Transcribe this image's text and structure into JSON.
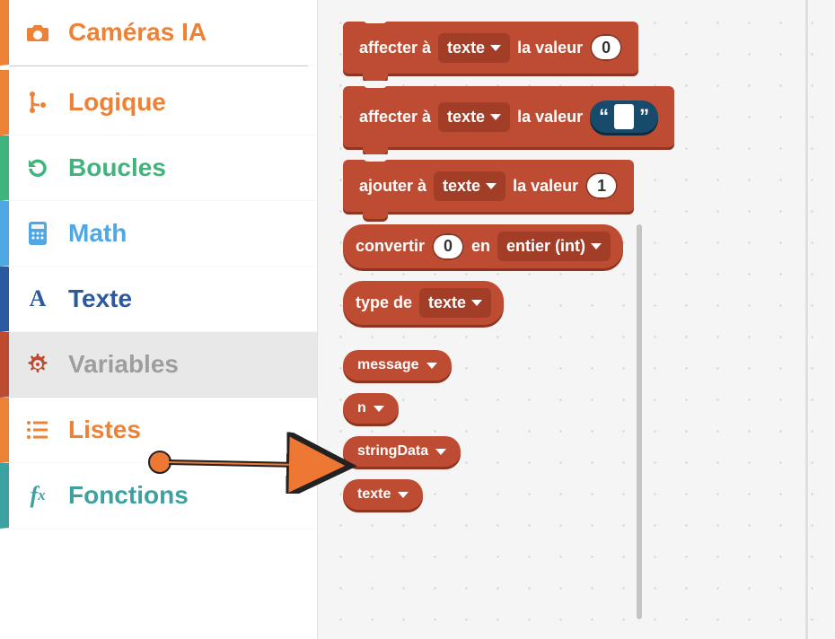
{
  "sidebar": {
    "items": [
      {
        "label": "Caméras IA",
        "icon": "camera"
      },
      {
        "label": "Logique",
        "icon": "branch"
      },
      {
        "label": "Boucles",
        "icon": "redo"
      },
      {
        "label": "Math",
        "icon": "calculator"
      },
      {
        "label": "Texte",
        "icon": "letter-a"
      },
      {
        "label": "Variables",
        "icon": "gear"
      },
      {
        "label": "Listes",
        "icon": "list"
      },
      {
        "label": "Fonctions",
        "icon": "fx"
      }
    ],
    "active_index": 5
  },
  "blocks": {
    "set1": {
      "prefix": "affecter à",
      "var": "texte",
      "mid": "la valeur",
      "value": "0"
    },
    "set2": {
      "prefix": "affecter à",
      "var": "texte",
      "mid": "la valeur",
      "value": ""
    },
    "add": {
      "prefix": "ajouter à",
      "var": "texte",
      "mid": "la valeur",
      "value": "1"
    },
    "conv": {
      "prefix": "convertir",
      "value": "0",
      "mid": "en",
      "type": "entier (int)"
    },
    "typeof": {
      "prefix": "type de",
      "var": "texte"
    },
    "var_message": "message",
    "var_n": "n",
    "var_stringdata": "stringData",
    "var_texte": "texte"
  },
  "string_quote_left": "“",
  "string_quote_right": "”"
}
